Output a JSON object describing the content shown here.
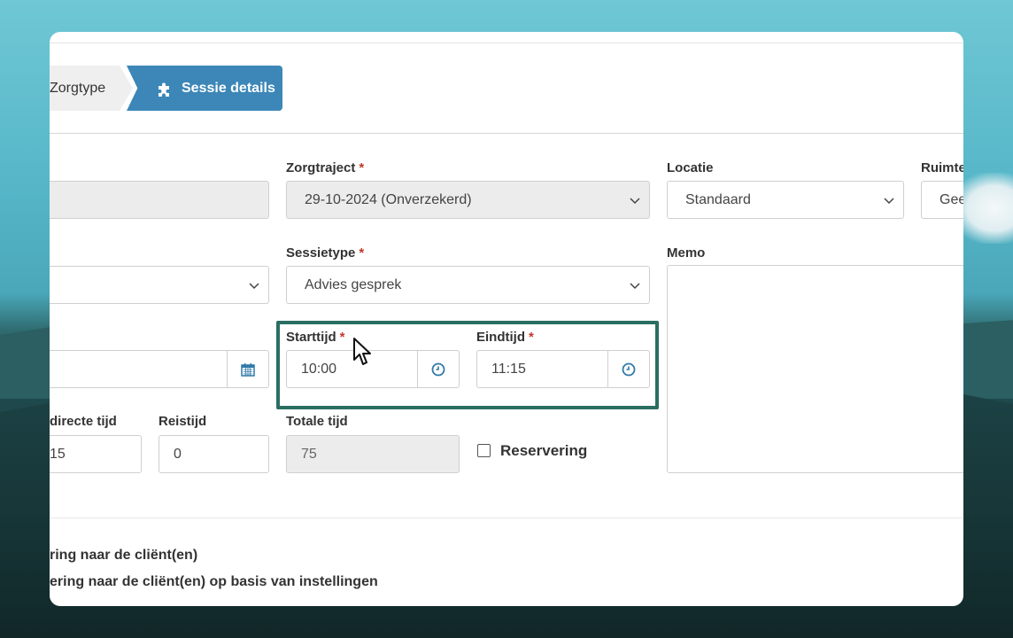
{
  "breadcrumb": {
    "previous_label": "Zorgtype",
    "active_label": "Sessie details"
  },
  "form": {
    "zorgtraject": {
      "label": "Zorgtraject",
      "value": "29-10-2024 (Onverzekerd)"
    },
    "locatie": {
      "label": "Locatie",
      "value": "Standaard"
    },
    "ruimte": {
      "label": "Ruimte",
      "value": "Gee"
    },
    "sessietype": {
      "label": "Sessietype",
      "value": "Advies gesprek"
    },
    "memo": {
      "label": "Memo"
    },
    "starttijd": {
      "label": "Starttijd",
      "value": "10:00"
    },
    "eindtijd": {
      "label": "Eindtijd",
      "value": "11:15"
    },
    "indirecte_tijd": {
      "label": "directe tijd",
      "value": "15"
    },
    "reistijd": {
      "label": "Reistijd",
      "value": "0"
    },
    "totale_tijd": {
      "label": "Totale tijd",
      "value": "75"
    },
    "reservering": {
      "label": "Reservering"
    },
    "required_mark": "*"
  },
  "options": {
    "option1": "ring naar de cliënt(en)",
    "option2": "ering naar de cliënt(en) op basis van instellingen"
  },
  "colors": {
    "accent": "#3c87b8",
    "highlight": "#2a6e62",
    "required": "#c0392b",
    "icon": "#2f79a8"
  }
}
